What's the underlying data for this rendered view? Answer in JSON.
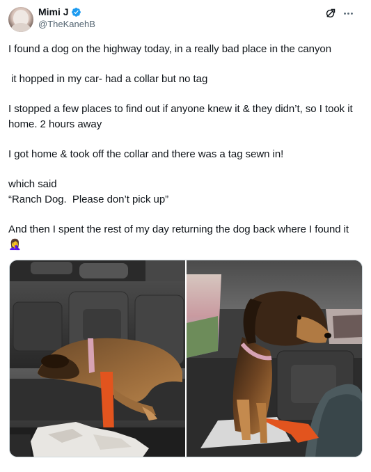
{
  "author": {
    "name": "Mimi J",
    "handle": "@TheKanehB",
    "verified": true,
    "avatar_icon": "avatar-photo",
    "verified_color": "#1d9bf0"
  },
  "actions": {
    "grok_icon": "grok-icon",
    "more_icon": "more-dots-icon"
  },
  "tweet": {
    "paragraphs": [
      "I found a dog on the highway today, in a really bad place in the canyon",
      " it hopped in my car- had a collar but no tag",
      "I stopped a few places to find out if anyone knew it & they didn’t, so I took it home. 2 hours away",
      "I got home & took off the collar and there was a tag sewn in!",
      "which said\n“Ranch Dog.  Please don’t pick up”",
      "And then I spent the rest of my day returning the dog back where I found it 🤦‍♀️"
    ]
  },
  "media": {
    "photos": [
      {
        "description_icon": "dog-lying-photo"
      },
      {
        "description_icon": "dog-sitting-photo"
      }
    ]
  },
  "colors": {
    "text": "#0f1419",
    "secondary_text": "#536471",
    "border": "#cfd9de"
  }
}
